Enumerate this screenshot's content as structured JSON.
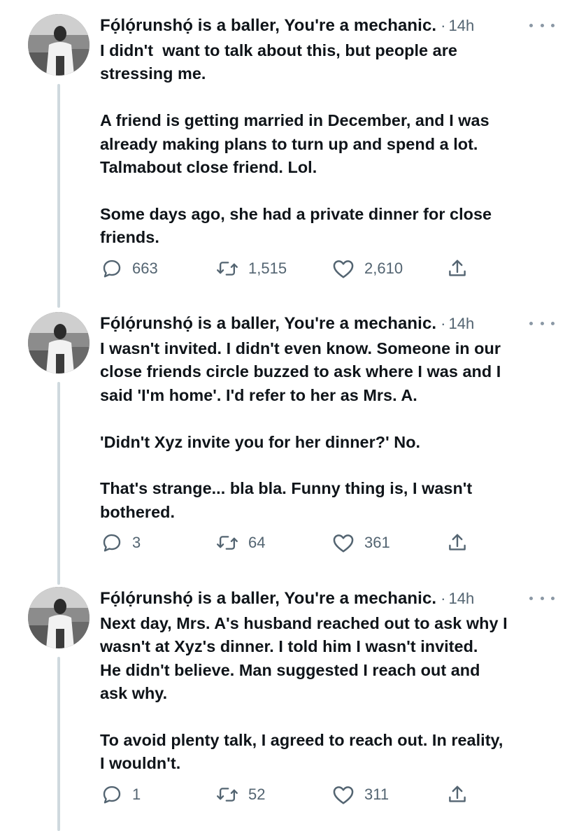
{
  "tweets": [
    {
      "author": "Fọ́lọ́runshọ́ is a baller, You're a mechanic.",
      "time": "14h",
      "paragraphs": [
        "I didn't  want to talk about this, but people are\nstressing me.",
        "A friend is getting married in December, and I was\nalready making plans to turn up and spend a lot.\nTalmabout close friend. Lol.",
        "Some days ago, she had a private dinner for close\nfriends."
      ],
      "replies": "663",
      "retweets": "1,515",
      "likes": "2,610"
    },
    {
      "author": "Fọ́lọ́runshọ́ is a baller, You're a mechanic.",
      "time": "14h",
      "paragraphs": [
        "I wasn't invited. I didn't even know. Someone in our\nclose friends circle buzzed to ask where I was and I\nsaid 'I'm home'. I'd refer to her as Mrs. A.",
        "'Didn't Xyz invite you for her dinner?' No.",
        "That's strange... bla bla. Funny thing is, I wasn't\nbothered."
      ],
      "replies": "3",
      "retweets": "64",
      "likes": "361"
    },
    {
      "author": "Fọ́lọ́runshọ́ is a baller, You're a mechanic.",
      "time": "14h",
      "paragraphs": [
        "Next day, Mrs. A's husband reached out to ask why I\nwasn't at Xyz's dinner. I told him I wasn't invited.\nHe didn't believe. Man suggested I reach out and\nask why.",
        "To avoid plenty talk, I agreed to reach out. In reality,\nI wouldn't."
      ],
      "replies": "1",
      "retweets": "52",
      "likes": "311"
    }
  ],
  "icons": {
    "reply": "reply-icon",
    "retweet": "retweet-icon",
    "like": "like-icon",
    "share": "share-icon",
    "more": "more-icon"
  },
  "colors": {
    "text": "#0f1419",
    "secondary": "#536471",
    "thread_line": "#cfd9de"
  }
}
